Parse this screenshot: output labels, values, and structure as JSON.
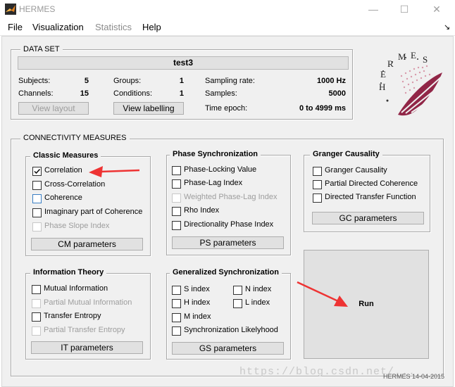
{
  "window": {
    "title": "HERMES",
    "minimize": "—",
    "maximize": "☐",
    "close": "✕"
  },
  "menu": {
    "file": "File",
    "visualization": "Visualization",
    "statistics": "Statistics",
    "help": "Help",
    "corner_arrow": "↘"
  },
  "dataset": {
    "section_title": "DATA SET",
    "name": "test3",
    "subjects_label": "Subjects:",
    "subjects_value": "5",
    "channels_label": "Channels:",
    "channels_value": "15",
    "groups_label": "Groups:",
    "groups_value": "1",
    "conditions_label": "Conditions:",
    "conditions_value": "1",
    "sampling_label": "Sampling rate:",
    "sampling_value": "1000 Hz",
    "samples_label": "Samples:",
    "samples_value": "5000",
    "epoch_label": "Time epoch:",
    "epoch_value": "0 to 4999 ms",
    "view_layout": "View layout",
    "view_labelling": "View labelling"
  },
  "logo": {
    "text": "H E R M E S"
  },
  "connectivity": {
    "section_title": "CONNECTIVITY MEASURES",
    "classic": {
      "title": "Classic Measures",
      "items": [
        {
          "label": "Correlation",
          "checked": true,
          "enabled": true
        },
        {
          "label": "Cross-Correlation",
          "checked": false,
          "enabled": true
        },
        {
          "label": "Coherence",
          "checked": false,
          "enabled": true
        },
        {
          "label": "Imaginary part of Coherence",
          "checked": false,
          "enabled": true
        },
        {
          "label": "Phase Slope Index",
          "checked": false,
          "enabled": false
        }
      ],
      "button": "CM parameters"
    },
    "phase": {
      "title": "Phase Synchronization",
      "items": [
        {
          "label": "Phase-Locking Value",
          "checked": false,
          "enabled": true
        },
        {
          "label": "Phase-Lag Index",
          "checked": false,
          "enabled": true
        },
        {
          "label": "Weighted Phase-Lag Index",
          "checked": false,
          "enabled": false
        },
        {
          "label": "Rho Index",
          "checked": false,
          "enabled": true
        },
        {
          "label": "Directionality Phase Index",
          "checked": false,
          "enabled": true
        }
      ],
      "button": "PS parameters"
    },
    "granger": {
      "title": "Granger Causality",
      "items": [
        {
          "label": "Granger Causality",
          "checked": false,
          "enabled": true
        },
        {
          "label": "Partial Directed Coherence",
          "checked": false,
          "enabled": true
        },
        {
          "label": "Directed Transfer Function",
          "checked": false,
          "enabled": true
        }
      ],
      "button": "GC parameters"
    },
    "info": {
      "title": "Information Theory",
      "items": [
        {
          "label": "Mutual Information",
          "checked": false,
          "enabled": true
        },
        {
          "label": "Partial Mutual Information",
          "checked": false,
          "enabled": false
        },
        {
          "label": "Transfer Entropy",
          "checked": false,
          "enabled": true
        },
        {
          "label": "Partial Transfer Entropy",
          "checked": false,
          "enabled": false
        }
      ],
      "button": "IT parameters"
    },
    "gensync": {
      "title": "Generalized Synchronization",
      "items": [
        {
          "label": "S index",
          "checked": false,
          "enabled": true
        },
        {
          "label": "N index",
          "checked": false,
          "enabled": true
        },
        {
          "label": "H index",
          "checked": false,
          "enabled": true
        },
        {
          "label": "L index",
          "checked": false,
          "enabled": true
        },
        {
          "label": "M index",
          "checked": false,
          "enabled": true
        },
        {
          "label": "Synchronization Likelyhood",
          "checked": false,
          "enabled": true
        }
      ],
      "button": "GS parameters"
    },
    "run": "Run"
  },
  "footer": {
    "version": "HERMES 14-04-2015",
    "watermark": "https://blog.csdn.net/..."
  },
  "colors": {
    "annotation_arrow": "#ee3333",
    "window_bg": "#f0f0f0"
  }
}
